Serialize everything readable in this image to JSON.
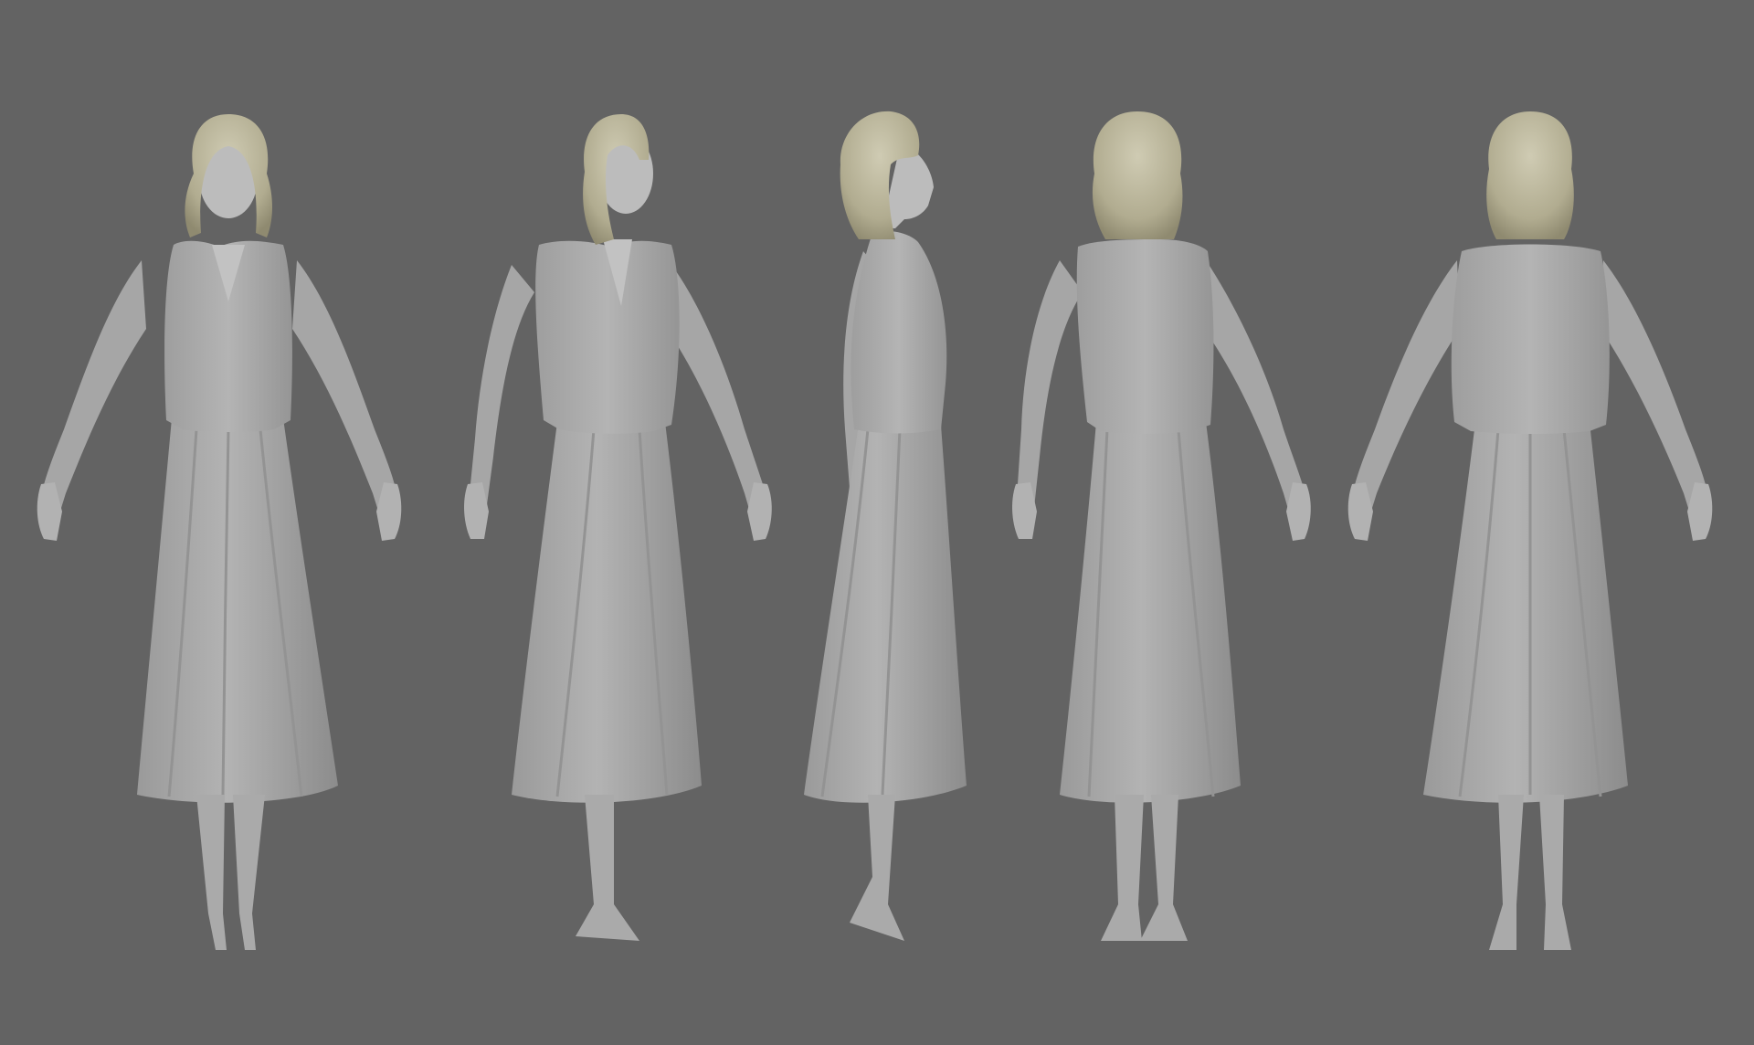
{
  "scene": {
    "background_color": "#636363",
    "figure_colors": {
      "body": "#a9a9a9",
      "body_shade": "#8f8f8f",
      "body_light": "#bdbdbd",
      "hair": "#b7b296",
      "hair_light": "#cfcbb3",
      "hair_shade": "#8f8a70",
      "skin_speckle": "#d8d8d8"
    },
    "views": [
      {
        "id": "front",
        "pose": "front"
      },
      {
        "id": "three-quarter-front",
        "pose": "three-quarter"
      },
      {
        "id": "side",
        "pose": "side"
      },
      {
        "id": "three-quarter-back",
        "pose": "three-quarter-back"
      },
      {
        "id": "back",
        "pose": "back"
      }
    ]
  }
}
